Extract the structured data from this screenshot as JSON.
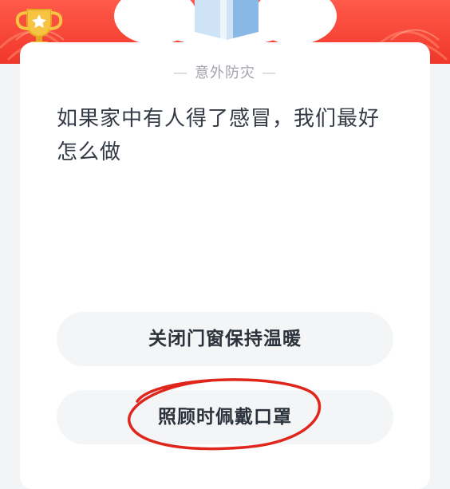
{
  "quiz": {
    "category": "意外防灾",
    "category_dash": "—",
    "question": "如果家中有人得了感冒，我们最好怎么做",
    "options": [
      {
        "label": "关闭门窗保持温暖"
      },
      {
        "label": "照顾时佩戴口罩",
        "circled": true
      }
    ]
  },
  "colors": {
    "banner_red": "#f0372a",
    "circle_mark": "#e0261c",
    "trophy_gold": "#f6c343"
  },
  "icons": {
    "trophy": "trophy-icon",
    "gift_box": "gift-box-icon"
  }
}
